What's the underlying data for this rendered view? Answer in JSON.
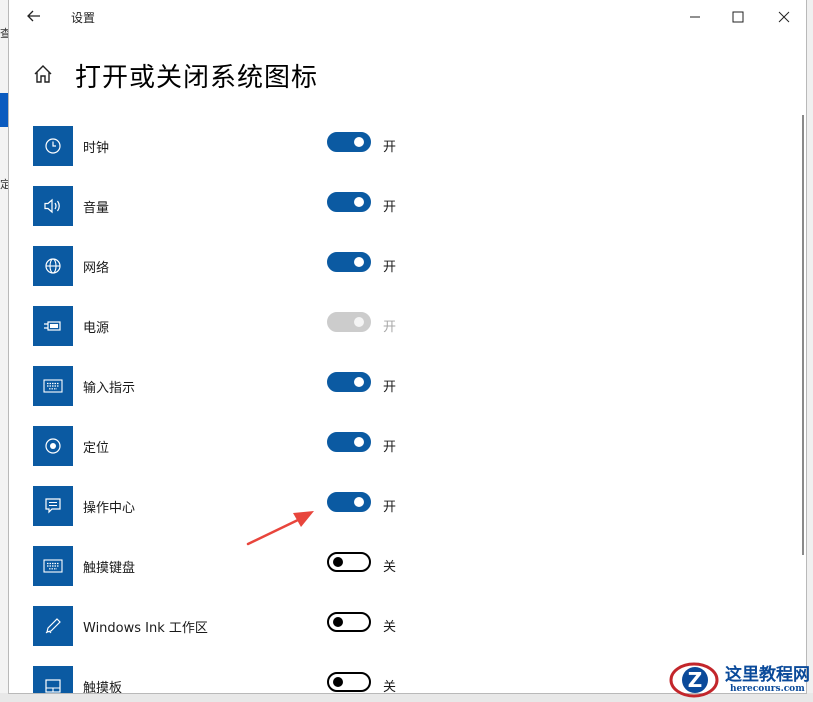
{
  "window": {
    "title": "设置"
  },
  "page": {
    "title": "打开或关闭系统图标"
  },
  "items": [
    {
      "label": "时钟",
      "icon": "clock-icon",
      "state": "开",
      "toggle": "on"
    },
    {
      "label": "音量",
      "icon": "volume-icon",
      "state": "开",
      "toggle": "on"
    },
    {
      "label": "网络",
      "icon": "globe-icon",
      "state": "开",
      "toggle": "on"
    },
    {
      "label": "电源",
      "icon": "battery-icon",
      "state": "开",
      "toggle": "disabled"
    },
    {
      "label": "输入指示",
      "icon": "keyboard-icon",
      "state": "开",
      "toggle": "on"
    },
    {
      "label": "定位",
      "icon": "location-icon",
      "state": "开",
      "toggle": "on"
    },
    {
      "label": "操作中心",
      "icon": "action-center-icon",
      "state": "开",
      "toggle": "on"
    },
    {
      "label": "触摸键盘",
      "icon": "keyboard-icon",
      "state": "关",
      "toggle": "off"
    },
    {
      "label": "Windows Ink 工作区",
      "icon": "pen-icon",
      "state": "关",
      "toggle": "off"
    },
    {
      "label": "触摸板",
      "icon": "touchpad-icon",
      "state": "关",
      "toggle": "off"
    }
  ],
  "colors": {
    "accent": "#0b5aa2",
    "annotation": "#e8453c"
  },
  "watermark": {
    "title": "这里教程网",
    "subtitle": "herecours.com",
    "logo_letter": "Z"
  }
}
